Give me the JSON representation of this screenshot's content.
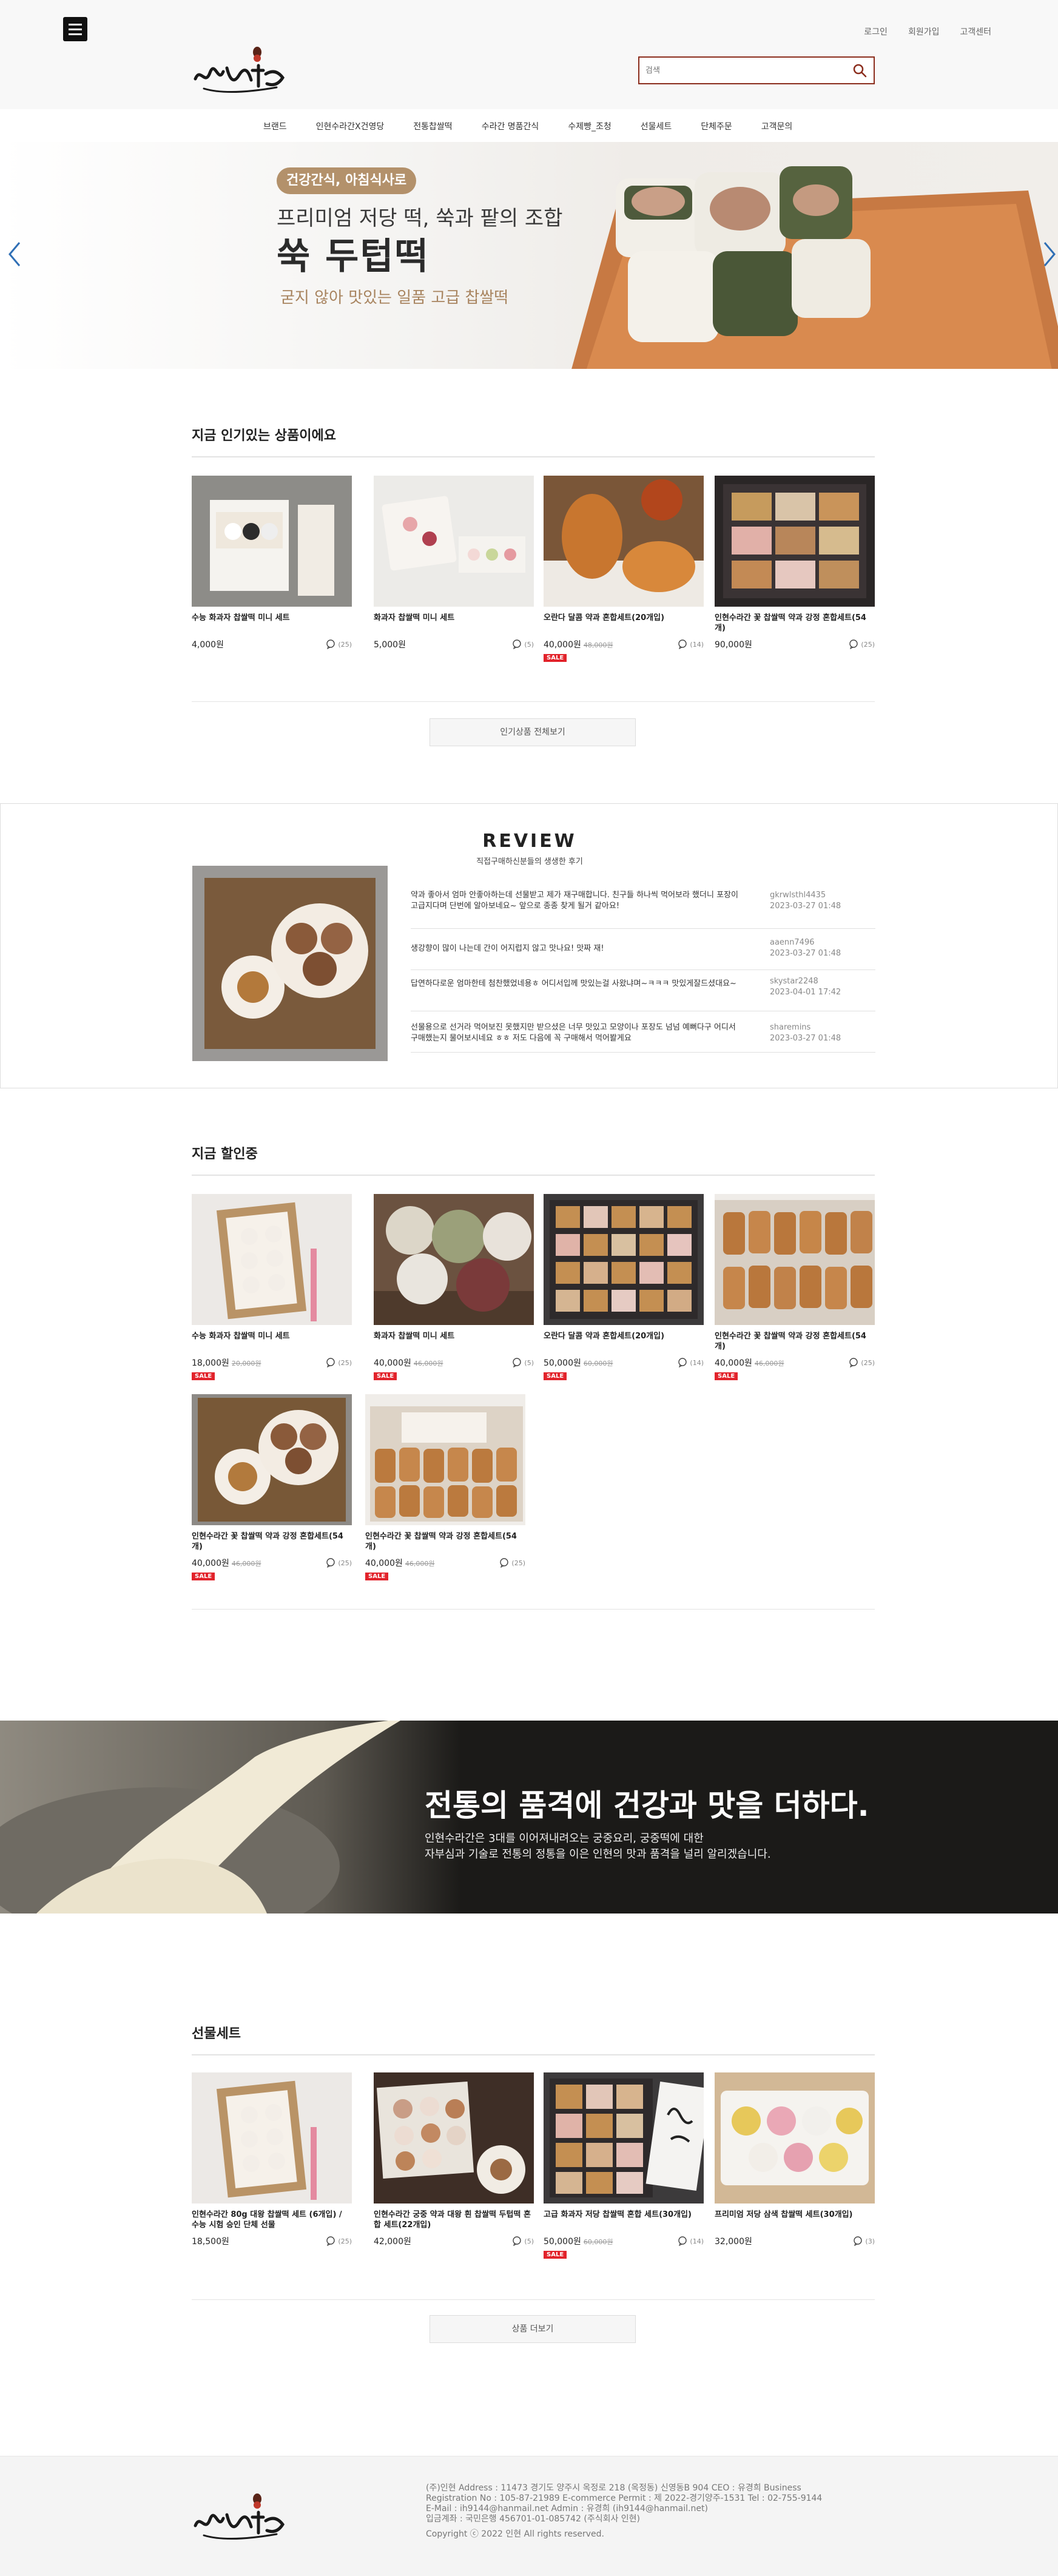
{
  "header": {
    "links": [
      "로그인",
      "회원가입",
      "고객센터"
    ],
    "search_placeholder": "검색"
  },
  "nav": {
    "items": [
      "브랜드",
      "인현수라간X건영당",
      "전통찹쌀떡",
      "수라간 명품간식",
      "수제빵_조청",
      "선물세트",
      "단체주문",
      "고객문의"
    ]
  },
  "hero": {
    "badge": "건강간식, 아침식사로",
    "subtitle": "프리미엄 저당 떡, 쑥과 팥의 조합",
    "title": "쑥 두텁떡",
    "desc": "굳지 않아 맛있는 일품 고급 찹쌀떡"
  },
  "popular": {
    "title": "지금 인기있는 상품이에요",
    "more": "인기상품 전체보기",
    "items": [
      {
        "name": "수능 화과자 찹쌀떡 미니 세트",
        "price": "4,000원",
        "orig": "",
        "sale": false,
        "comments": "(25)"
      },
      {
        "name": "화과자 찹쌀떡 미니 세트",
        "price": "5,000원",
        "orig": "",
        "sale": false,
        "comments": "(5)"
      },
      {
        "name": "오란다 달콤 약과 혼합세트(20개입)",
        "price": "40,000원",
        "orig": "48,000원",
        "sale": true,
        "comments": "(14)"
      },
      {
        "name": "인현수라간 꽃 찹쌀떡 약과 강정 혼합세트(54개)",
        "price": "90,000원",
        "orig": "",
        "sale": false,
        "comments": "(25)"
      }
    ]
  },
  "review": {
    "title": "REVIEW",
    "subtitle": "직접구매하신분들의 생생한 후기",
    "items": [
      {
        "text": "약과 좋아서 엄마 안좋아하는데 선물받고 제가 재구매합니다. 친구들 하나씩 먹어보라 했더니 포장이 고급지다며 단번에 알아보네요~ 앞으로 종종 찾게 될거 같아요!",
        "user": "gkrwlsthl4435",
        "date": "2023-03-27 01:48"
      },
      {
        "text": "생강향이 많이 나는데 간이 어지럽지 않고 맛나요! 맛짜 재!",
        "user": "aaenn7496",
        "date": "2023-03-27 01:48"
      },
      {
        "text": "답연하다로운 엄마한테 첨찬했었네용ㅎ 어디서입께 맛있는걸 사왔냐며~ㅋㅋㅋ 맛있게잘드셨대요~",
        "user": "skystar2248",
        "date": "2023-04-01 17:42"
      },
      {
        "text": "선물용으로 선거라 먹어보진 못했지만 받으셨은 너무 맛있고 모양이나 포장도 넘넘 예뻐다구 어디서 구매했는지 물어보시네요 ㅎㅎ 저도 다음에 꼭 구매해서 먹어봘게요",
        "user": "sharemins",
        "date": "2023-03-27 01:48"
      }
    ]
  },
  "discount": {
    "title": "지금 할인중",
    "items": [
      {
        "name": "수능 화과자 찹쌀떡 미니 세트",
        "price": "18,000원",
        "orig": "20,000원",
        "sale": true,
        "comments": "(25)"
      },
      {
        "name": "화과자 찹쌀떡 미니 세트",
        "price": "40,000원",
        "orig": "46,000원",
        "sale": true,
        "comments": "(5)"
      },
      {
        "name": "오란다 달콤 약과 혼합세트(20개입)",
        "price": "50,000원",
        "orig": "60,000원",
        "sale": true,
        "comments": "(14)"
      },
      {
        "name": "인현수라간 꽃 찹쌀떡 약과 강정 혼합세트(54개)",
        "price": "40,000원",
        "orig": "46,000원",
        "sale": true,
        "comments": "(25)"
      },
      {
        "name": "인현수라간 꽃 찹쌀떡 약과 강정 혼합세트(54개)",
        "price": "40,000원",
        "orig": "46,000원",
        "sale": true,
        "comments": "(25)"
      },
      {
        "name": "인현수라간 꽃 찹쌀떡 약과 강정 혼합세트(54개)",
        "price": "40,000원",
        "orig": "46,000원",
        "sale": true,
        "comments": "(25)"
      }
    ]
  },
  "banner": {
    "title": "전통의 품격에 건강과 맛을 더하다.",
    "desc1": "인현수라간은 3대를 이어져내려오는 궁중요리, 궁중떡에 대한",
    "desc2": "자부심과 기술로 전통의 정통을 이은 인현의 맛과 품격을 널리 알리겠습니다."
  },
  "gifts": {
    "title": "선물세트",
    "more": "상품 더보기",
    "items": [
      {
        "name": "인현수라간 80g 대왕 찹쌀떡 세트 (6개입) / 수능 시험 승인 단체 선물",
        "price": "18,500원",
        "orig": "",
        "sale": false,
        "comments": "(25)"
      },
      {
        "name": "인현수라간 궁중 약과 대왕 흰 찹쌀떡 두텁떡 혼합 세트(22개입)",
        "price": "42,000원",
        "orig": "",
        "sale": false,
        "comments": "(5)"
      },
      {
        "name": "고급 화과자 저당 찹쌀떡 혼합 세트(30개입)",
        "price": "50,000원",
        "orig": "60,000원",
        "sale": true,
        "comments": "(14)"
      },
      {
        "name": "프리미엄 저당 삼색 찹쌀떡 세트(30개입)",
        "price": "32,000원",
        "orig": "",
        "sale": false,
        "comments": "(3)"
      }
    ]
  },
  "footer": {
    "line1": "(주)인현 Address : 11473 경기도 양주시 옥정로 218 (옥정동) 신영동B 904 CEO : 유경희   Business",
    "line2": "Registration No : 105-87-21989   E-commerce Permit : 제 2022-경기양주-1531 Tel : 02-755-9144",
    "line3": "E-Mail : ih9144@hanmail.net   Admin : 유경희 (ih9144@hanmail.net)",
    "line4": "입금계좌 : 국민은행 456701-01-085742 (주식회사 인현)",
    "copyright": "Copyright ⓒ 2022 인현 All rights reserved."
  },
  "sale_label": "SALE",
  "colors": {
    "accent": "#8b2d1d",
    "sale": "#e2232b",
    "hero_badge": "#b3916b",
    "hero_desc": "#a8845f",
    "banner_bg": "#1b1a18"
  }
}
